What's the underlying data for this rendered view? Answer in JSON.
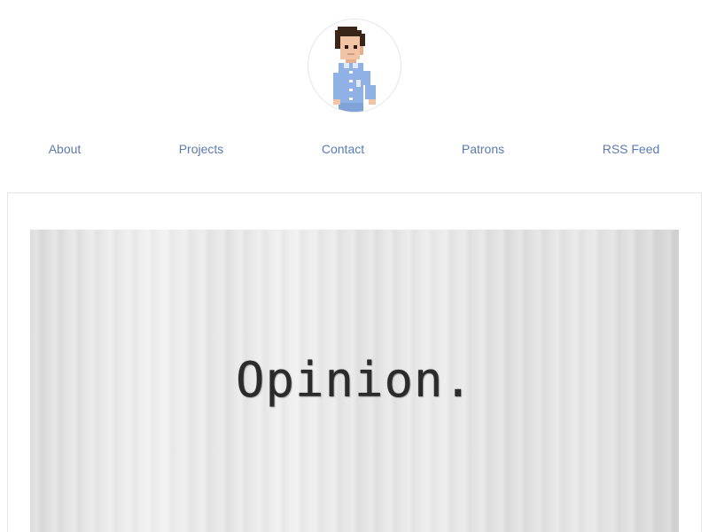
{
  "header": {
    "avatar_icon": "pixel-art-man-avatar-icon"
  },
  "nav": {
    "items": [
      {
        "label": "About"
      },
      {
        "label": "Projects"
      },
      {
        "label": "Contact"
      },
      {
        "label": "Patrons"
      },
      {
        "label": "RSS Feed"
      }
    ]
  },
  "article": {
    "hero_text": "Opinion."
  },
  "colors": {
    "link": "#5b7bb0",
    "card_border": "#e4e4e4",
    "avatar_border": "#e6e6e6",
    "shirt": "#8fb1e6",
    "hair": "#3a2618",
    "skin": "#f0c4a4"
  }
}
